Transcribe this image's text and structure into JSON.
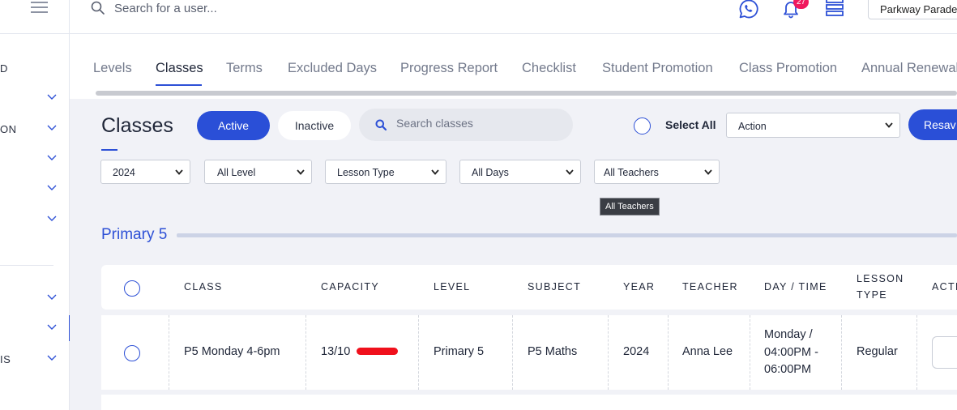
{
  "header": {
    "search_placeholder": "Search for a user...",
    "notification_count": "27",
    "branch": "Parkway Parade"
  },
  "sidebar": {
    "items": [
      {
        "label": "D"
      },
      {
        "label": ""
      },
      {
        "label": "ON"
      },
      {
        "label": ""
      },
      {
        "label": ""
      },
      {
        "label": ""
      },
      {
        "label": ""
      },
      {
        "label": ""
      },
      {
        "label": "IS"
      }
    ]
  },
  "tabs": [
    "Levels",
    "Classes",
    "Terms",
    "Excluded Days",
    "Progress Report",
    "Checklist",
    "Student Promotion",
    "Class Promotion",
    "Annual Renewal"
  ],
  "toolbar": {
    "title": "Classes",
    "active_label": "Active",
    "inactive_label": "Inactive",
    "search_placeholder": "Search classes",
    "select_all_label": "Select All",
    "action_select": "Action",
    "resave_label": "Resav"
  },
  "filters": {
    "year": "2024",
    "level": "All Level",
    "lesson_type": "Lesson Type",
    "days": "All Days",
    "teachers": "All Teachers"
  },
  "tooltip": "All Teachers",
  "section_title": "Primary 5",
  "table": {
    "headers": {
      "class": "CLASS",
      "capacity": "CAPACITY",
      "level": "LEVEL",
      "subject": "SUBJECT",
      "year": "YEAR",
      "teacher": "TEACHER",
      "day_time": "DAY / TIME",
      "lesson_type_1": "LESSON",
      "lesson_type_2": "TYPE",
      "action": "ACTI"
    },
    "rows": [
      {
        "class": "P5 Monday 4-6pm",
        "capacity": "13/10",
        "level": "Primary 5",
        "subject": "P5 Maths",
        "year": "2024",
        "teacher": "Anna Lee",
        "day_time_1": "Monday /",
        "day_time_2": "04:00PM -",
        "day_time_3": "06:00PM",
        "lesson_type": "Regular"
      }
    ]
  },
  "colors": {
    "accent": "#2a4fd7",
    "over_capacity": "#f0101c",
    "badge": "#f0185d"
  }
}
